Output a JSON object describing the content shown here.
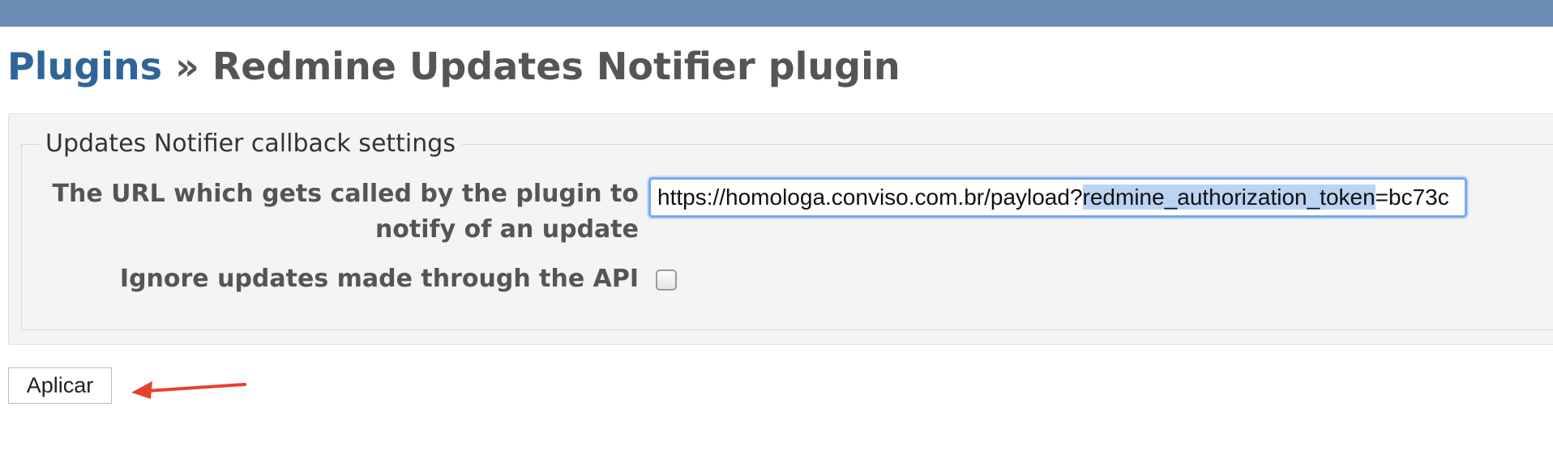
{
  "page": {
    "breadcrumb_link": "Plugins",
    "breadcrumb_separator": " » ",
    "title": "Redmine Updates Notifier plugin"
  },
  "settings": {
    "legend": "Updates Notifier callback settings",
    "url_label_line1": "The URL which gets called by the plugin to",
    "url_label_line2": "notify of an update",
    "url_value_prefix": "https://homologa.conviso.com.br/payload?",
    "url_value_selected": "redmine_authorization_token",
    "url_value_suffix": "=bc73c",
    "ignore_api_label": "Ignore updates made through the API",
    "ignore_api_checked": false
  },
  "actions": {
    "apply_label": "Aplicar"
  },
  "colors": {
    "topbar": "#6a8cb3",
    "link": "#2f6599",
    "arrow": "#e8402f",
    "focus_ring": "#7aa7ec"
  }
}
